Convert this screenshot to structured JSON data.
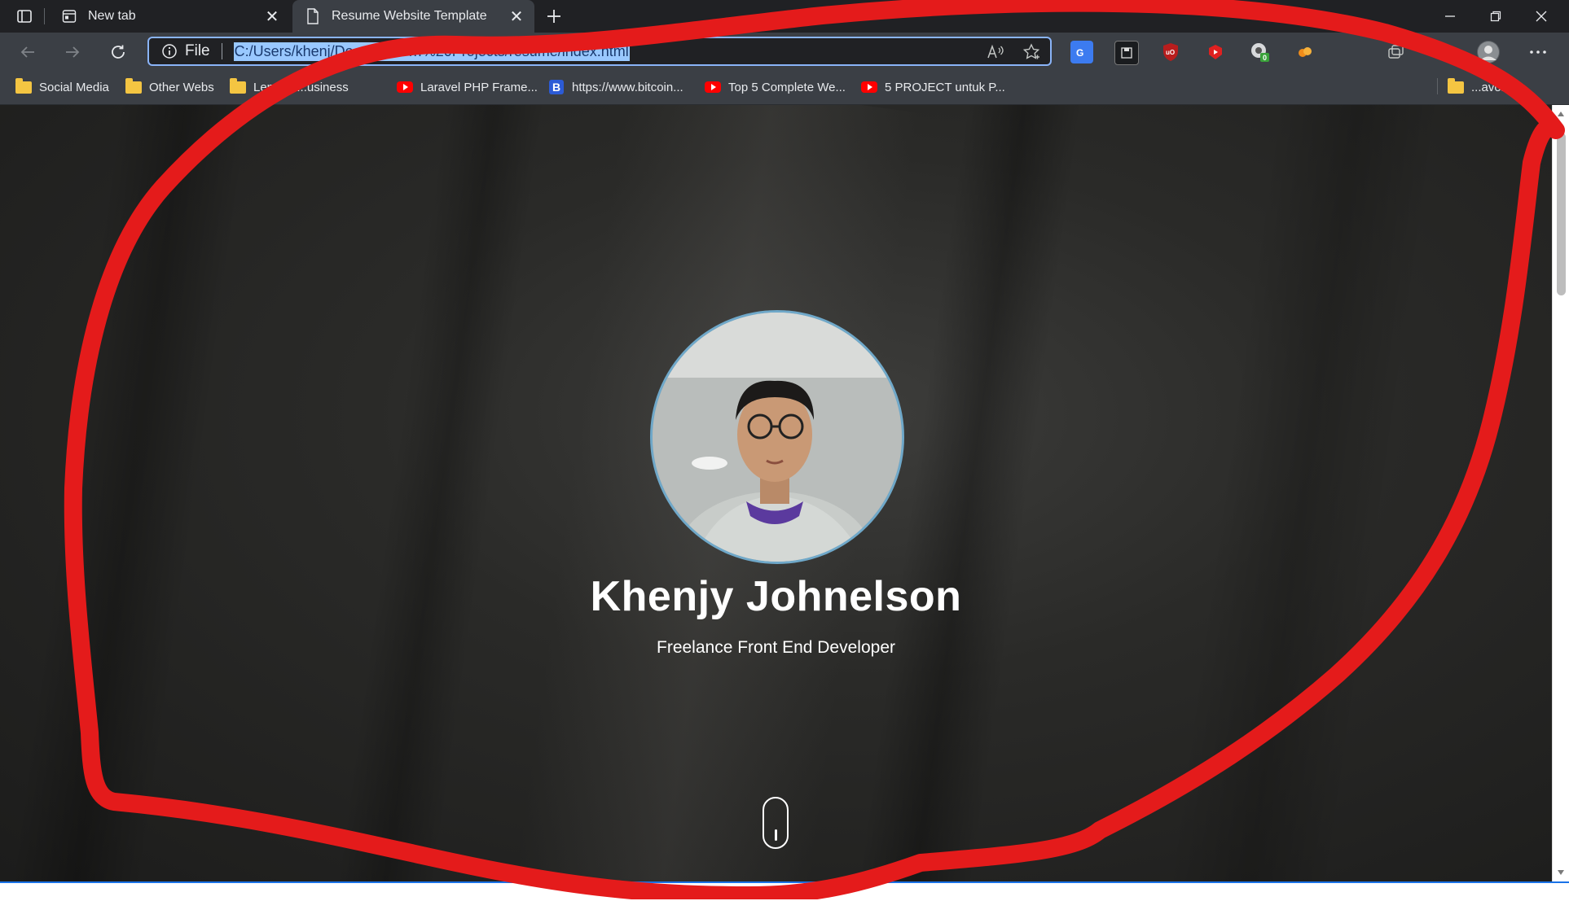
{
  "browser": {
    "tabs": [
      {
        "title": "New tab",
        "icon": "new-tab-page-icon",
        "active": false
      },
      {
        "title": "Resume Website Template",
        "icon": "document-icon",
        "active": true
      }
    ],
    "address_bar": {
      "scheme_label": "File",
      "url": "C:/Users/khenj/Docume…  …%20Projects/resume/index.html"
    },
    "bookmarks": [
      {
        "label": "Social Media",
        "icon": "folder-icon"
      },
      {
        "label": "Other Webs",
        "icon": "folder-icon"
      },
      {
        "label": "Lenovo ...usiness",
        "icon": "folder-icon"
      },
      {
        "label": "Laravel PHP Frame...",
        "icon": "youtube-icon"
      },
      {
        "label": "https://www.bitcoin...",
        "icon": "b-site-icon"
      },
      {
        "label": "Top 5 Complete We...",
        "icon": "youtube-icon"
      },
      {
        "label": "5 PROJECT untuk P...",
        "icon": "youtube-icon"
      },
      {
        "label": "...avorites",
        "icon": "folder-icon"
      }
    ],
    "extensions": [
      {
        "name": "translate-extension-icon",
        "color": "#4a8af4"
      },
      {
        "name": "save-extension-icon",
        "color": "#2d2f33"
      },
      {
        "name": "ublock-extension-icon",
        "color": "#b81d1d"
      },
      {
        "name": "youtube-extension-icon",
        "color": "#e02020"
      },
      {
        "name": "monitor-extension-icon",
        "badge": "0",
        "color": "#d7d9db"
      },
      {
        "name": "orange-extension-icon",
        "color": "#f08c1a"
      }
    ]
  },
  "page": {
    "name": "Khenjy Johnelson",
    "subtitle": "Freelance Front End Developer"
  },
  "colors": {
    "annotation_stroke": "#e41b1b",
    "accent": "#1a73e8"
  }
}
